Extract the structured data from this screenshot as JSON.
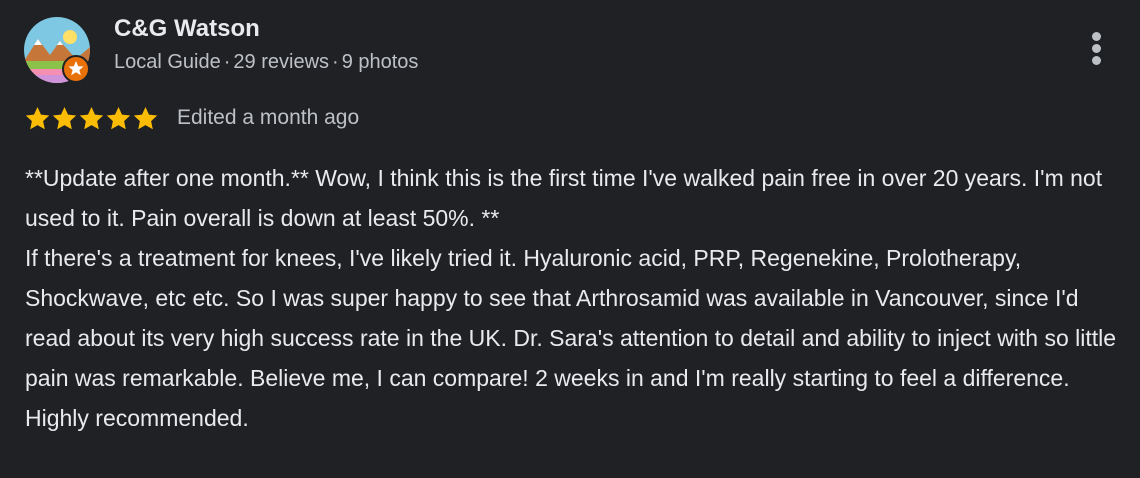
{
  "reviewer": {
    "name": "C&G Watson",
    "level": "Local Guide",
    "reviews": "29 reviews",
    "photos": "9 photos",
    "separator": "·",
    "avatar_icon": "landscape-avatar-icon",
    "badge_icon": "local-guide-star-badge-icon"
  },
  "rating": {
    "stars": 5,
    "max": 5,
    "star_color": "#fbbc04"
  },
  "edited": "Edited a month ago",
  "review_text": {
    "line1": "**Update after one month.** Wow, I think this is the first time I've walked pain free in over 20 years. I'm not used to it. Pain overall is down at least 50%. **",
    "line2": "If there's a treatment for knees, I've likely tried it. Hyaluronic acid, PRP, Regenekine, Prolotherapy, Shockwave, etc etc. So I was super happy to see that Arthrosamid was available in Vancouver, since I'd read about its very high success rate in the UK. Dr. Sara's attention to detail and ability to inject with so little pain was remarkable. Believe me, I can compare! 2 weeks in and I'm really starting to feel a difference. Highly recommended."
  },
  "colors": {
    "background": "#202124",
    "primary_text": "#e8eaed",
    "secondary_text": "#bdc1c6",
    "badge": "#e8710a"
  },
  "menu_icon": "more-vert-icon"
}
